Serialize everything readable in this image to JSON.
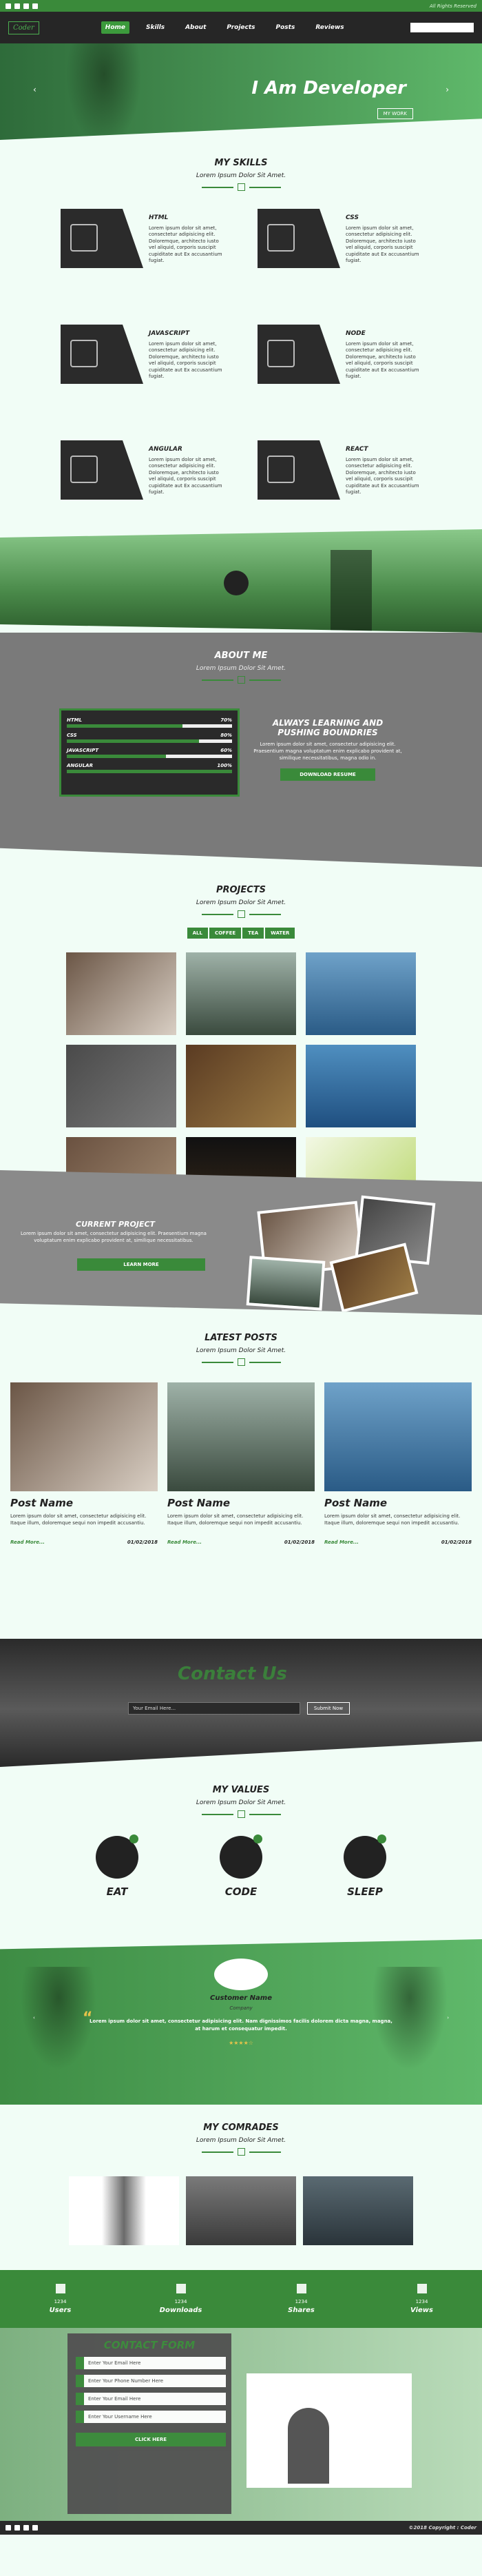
{
  "topbar": {
    "right": "All Rights Reserved"
  },
  "logo": "Coder",
  "nav": {
    "items": [
      "Home",
      "Skills",
      "About",
      "Projects",
      "Posts",
      "Reviews"
    ]
  },
  "hero": {
    "title": "I Am Developer",
    "button": "MY WORK"
  },
  "skills": {
    "title": "MY SKILLS",
    "subtitle": "Lorem Ipsum Dolor Sit Amet.",
    "items": [
      {
        "name": "HTML",
        "text": "Lorem ipsum dolor sit amet, consectetur adipisicing elit. Doloremque, architecto iusto vel aliquid, corporis suscipit cupiditate aut Ex accusantium fugiat."
      },
      {
        "name": "CSS",
        "text": "Lorem ipsum dolor sit amet, consectetur adipisicing elit. Doloremque, architecto iusto vel aliquid, corporis suscipit cupiditate aut Ex accusantium fugiat."
      },
      {
        "name": "JAVASCRIPT",
        "text": "Lorem ipsum dolor sit amet, consectetur adipisicing elit. Doloremque, architecto iusto vel aliquid, corporis suscipit cupiditate aut Ex accusantium fugiat."
      },
      {
        "name": "NODE",
        "text": "Lorem ipsum dolor sit amet, consectetur adipisicing elit. Doloremque, architecto iusto vel aliquid, corporis suscipit cupiditate aut Ex accusantium fugiat."
      },
      {
        "name": "ANGULAR",
        "text": "Lorem ipsum dolor sit amet, consectetur adipisicing elit. Doloremque, architecto iusto vel aliquid, corporis suscipit cupiditate aut Ex accusantium fugiat."
      },
      {
        "name": "REACT",
        "text": "Lorem ipsum dolor sit amet, consectetur adipisicing elit. Doloremque, architecto iusto vel aliquid, corporis suscipit cupiditate aut Ex accusantium fugiat."
      }
    ]
  },
  "about": {
    "title": "ABOUT ME",
    "subtitle": "Lorem Ipsum Dolor Sit Amet.",
    "bars": [
      {
        "label": "HTML",
        "pct": "70%",
        "value": 0.7
      },
      {
        "label": "CSS",
        "pct": "80%",
        "value": 0.8
      },
      {
        "label": "JAVASCRIPT",
        "pct": "60%",
        "value": 0.6
      },
      {
        "label": "ANGULAR",
        "pct": "100%",
        "value": 1.0
      }
    ],
    "heading": "ALWAYS LEARNING AND PUSHING BOUNDRIES",
    "text": "Lorem ipsum dolor sit amet, consectetur adipisicing elit. Praesentium magna voluptatum enim explicabo provident at, similique necessitatibus, magna odio in.",
    "button": "DOWNLOAD RESUME"
  },
  "projects": {
    "title": "PROJECTS",
    "subtitle": "Lorem Ipsum Dolor Sit Amet.",
    "filters": [
      "ALL",
      "COFFEE",
      "TEA",
      "WATER"
    ]
  },
  "current": {
    "title": "CURRENT PROJECT",
    "text": "Lorem ipsum dolor sit amet, consectetur adipisicing elit. Praesentium magna voluptatum enim explicabo provident at, similique necessitatibus.",
    "button": "LEARN MORE"
  },
  "posts": {
    "title": "LATEST POSTS",
    "subtitle": "Lorem Ipsum Dolor Sit Amet.",
    "items": [
      {
        "title": "Post Name",
        "text": "Lorem ipsum dolor sit amet, consectetur adipisicing elit. Itaque illum, doloremque sequi non impedit accusantiu.",
        "more": "Read More...",
        "date": "01/02/2018"
      },
      {
        "title": "Post Name",
        "text": "Lorem ipsum dolor sit amet, consectetur adipisicing elit. Itaque illum, doloremque sequi non impedit accusantiu.",
        "more": "Read More...",
        "date": "01/02/2018"
      },
      {
        "title": "Post Name",
        "text": "Lorem ipsum dolor sit amet, consectetur adipisicing elit. Itaque illum, doloremque sequi non impedit accusantiu.",
        "more": "Read More...",
        "date": "01/02/2018"
      }
    ]
  },
  "contactus": {
    "title": "Contact Us",
    "placeholder": "Your Email Here...",
    "button": "Submit Now"
  },
  "values": {
    "title": "MY VALUES",
    "subtitle": "Lorem Ipsum Dolor Sit Amet.",
    "items": [
      "EAT",
      "CODE",
      "SLEEP"
    ]
  },
  "testimonial": {
    "name": "Customer Name",
    "company": "Company",
    "text": "Lorem ipsum dolor sit amet, consectetur adipisicing elit. Nam dignissimos facilis dolorem dicta magna, magna, at harum et consequatur impedit.",
    "stars": "★★★★☆"
  },
  "comrades": {
    "title": "MY COMRADES",
    "subtitle": "Lorem Ipsum Dolor Sit Amet."
  },
  "stats": [
    {
      "num": "1234",
      "label": "Users"
    },
    {
      "num": "1234",
      "label": "Downloads"
    },
    {
      "num": "1234",
      "label": "Shares"
    },
    {
      "num": "1234",
      "label": "Views"
    }
  ],
  "form": {
    "title": "CONTACT FORM",
    "fields": [
      "Enter Your Email Here",
      "Enter Your Phone Number Here",
      "Enter Your Email Here",
      "Enter Your Username Here"
    ],
    "button": "CLICK HERE"
  },
  "footer": {
    "copyright": "©2018 Copyright : Coder"
  }
}
